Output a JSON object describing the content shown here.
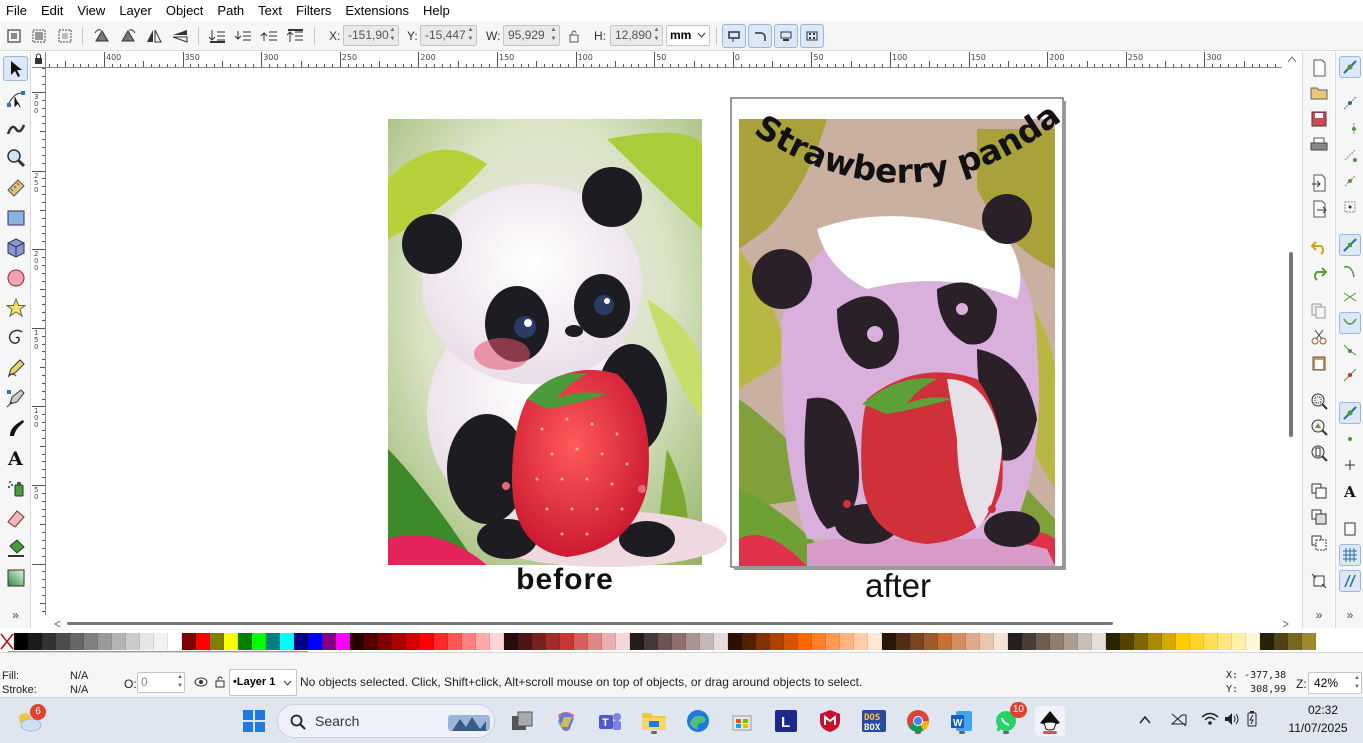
{
  "menu": [
    "File",
    "Edit",
    "View",
    "Layer",
    "Object",
    "Path",
    "Text",
    "Filters",
    "Extensions",
    "Help"
  ],
  "toolbar": {
    "x_label": "X:",
    "x_value": "-151,90",
    "y_label": "Y:",
    "y_value": "-15,447",
    "w_label": "W:",
    "w_value": "95,929",
    "h_label": "H:",
    "h_value": "12,890",
    "unit": "mm"
  },
  "ruler": {
    "h_labels": [
      "400",
      "350",
      "300",
      "250",
      "200",
      "150",
      "100",
      "50",
      "0",
      "50",
      "100",
      "150",
      "200",
      "250",
      "300"
    ],
    "v_labels": [
      "300",
      "250",
      "200",
      "150",
      "100",
      "50"
    ]
  },
  "canvas": {
    "before_caption": "before",
    "after_caption": "after",
    "after_title": "Strawberry panda"
  },
  "status": {
    "fill_label": "Fill:",
    "fill_value": "N/A",
    "stroke_label": "Stroke:",
    "stroke_value": "N/A",
    "opacity_label": "O:",
    "opacity_value": "0",
    "layer": "•Layer 1",
    "message": "No objects selected. Click, Shift+click, Alt+scroll mouse on top of objects, or drag around objects to select.",
    "cursor_x": "X: -377,38",
    "cursor_y": "Y:  308,99",
    "zoom_label": "Z:",
    "zoom": "42%"
  },
  "taskbar": {
    "weather_badge": "6",
    "search_placeholder": "Search",
    "whatsapp_badge": "10",
    "time": "02:32",
    "date": "11/07/2025"
  },
  "palette_colors": [
    "#000000",
    "#1a1a1a",
    "#333333",
    "#4d4d4d",
    "#666666",
    "#808080",
    "#999999",
    "#b3b3b3",
    "#cccccc",
    "#e6e6e6",
    "#f2f2f2",
    "#ffffff",
    "#800000",
    "#ff0000",
    "#808000",
    "#ffff00",
    "#008000",
    "#00ff00",
    "#008080",
    "#00ffff",
    "#000080",
    "#0000ff",
    "#800080",
    "#ff00ff",
    "#2b0000",
    "#550000",
    "#800000",
    "#aa0000",
    "#d40000",
    "#ff0000",
    "#ff2a2a",
    "#ff5555",
    "#ff8080",
    "#ffaaaa",
    "#ffd5d5",
    "#280b0b",
    "#501616",
    "#782121",
    "#a02c2c",
    "#c83737",
    "#d35f5f",
    "#de8787",
    "#e9afaf",
    "#f4d7d7",
    "#241c1c",
    "#483737",
    "#6c5353",
    "#916f6f",
    "#ac9393",
    "#c8b7b7",
    "#e3dbdb",
    "#2b1100",
    "#552200",
    "#803300",
    "#aa4400",
    "#d45500",
    "#ff6600",
    "#ff7f2a",
    "#ff9955",
    "#ffb380",
    "#ffccaa",
    "#ffe6d5",
    "#28170b",
    "#502d16",
    "#784421",
    "#a05a2c",
    "#c87137",
    "#d38d5f",
    "#deaa87",
    "#e9c6af",
    "#f4e3d7",
    "#241f1c",
    "#483e37",
    "#6c5d53",
    "#917c6f",
    "#ac9d93",
    "#c8beb7",
    "#e3dedb",
    "#2b2200",
    "#554400",
    "#806600",
    "#aa8800",
    "#d4aa00",
    "#ffcc00",
    "#ffd42a",
    "#ffdd55",
    "#ffe680",
    "#ffeeaa",
    "#fff6d5",
    "#28220b",
    "#504416",
    "#786721",
    "#a0892c"
  ]
}
